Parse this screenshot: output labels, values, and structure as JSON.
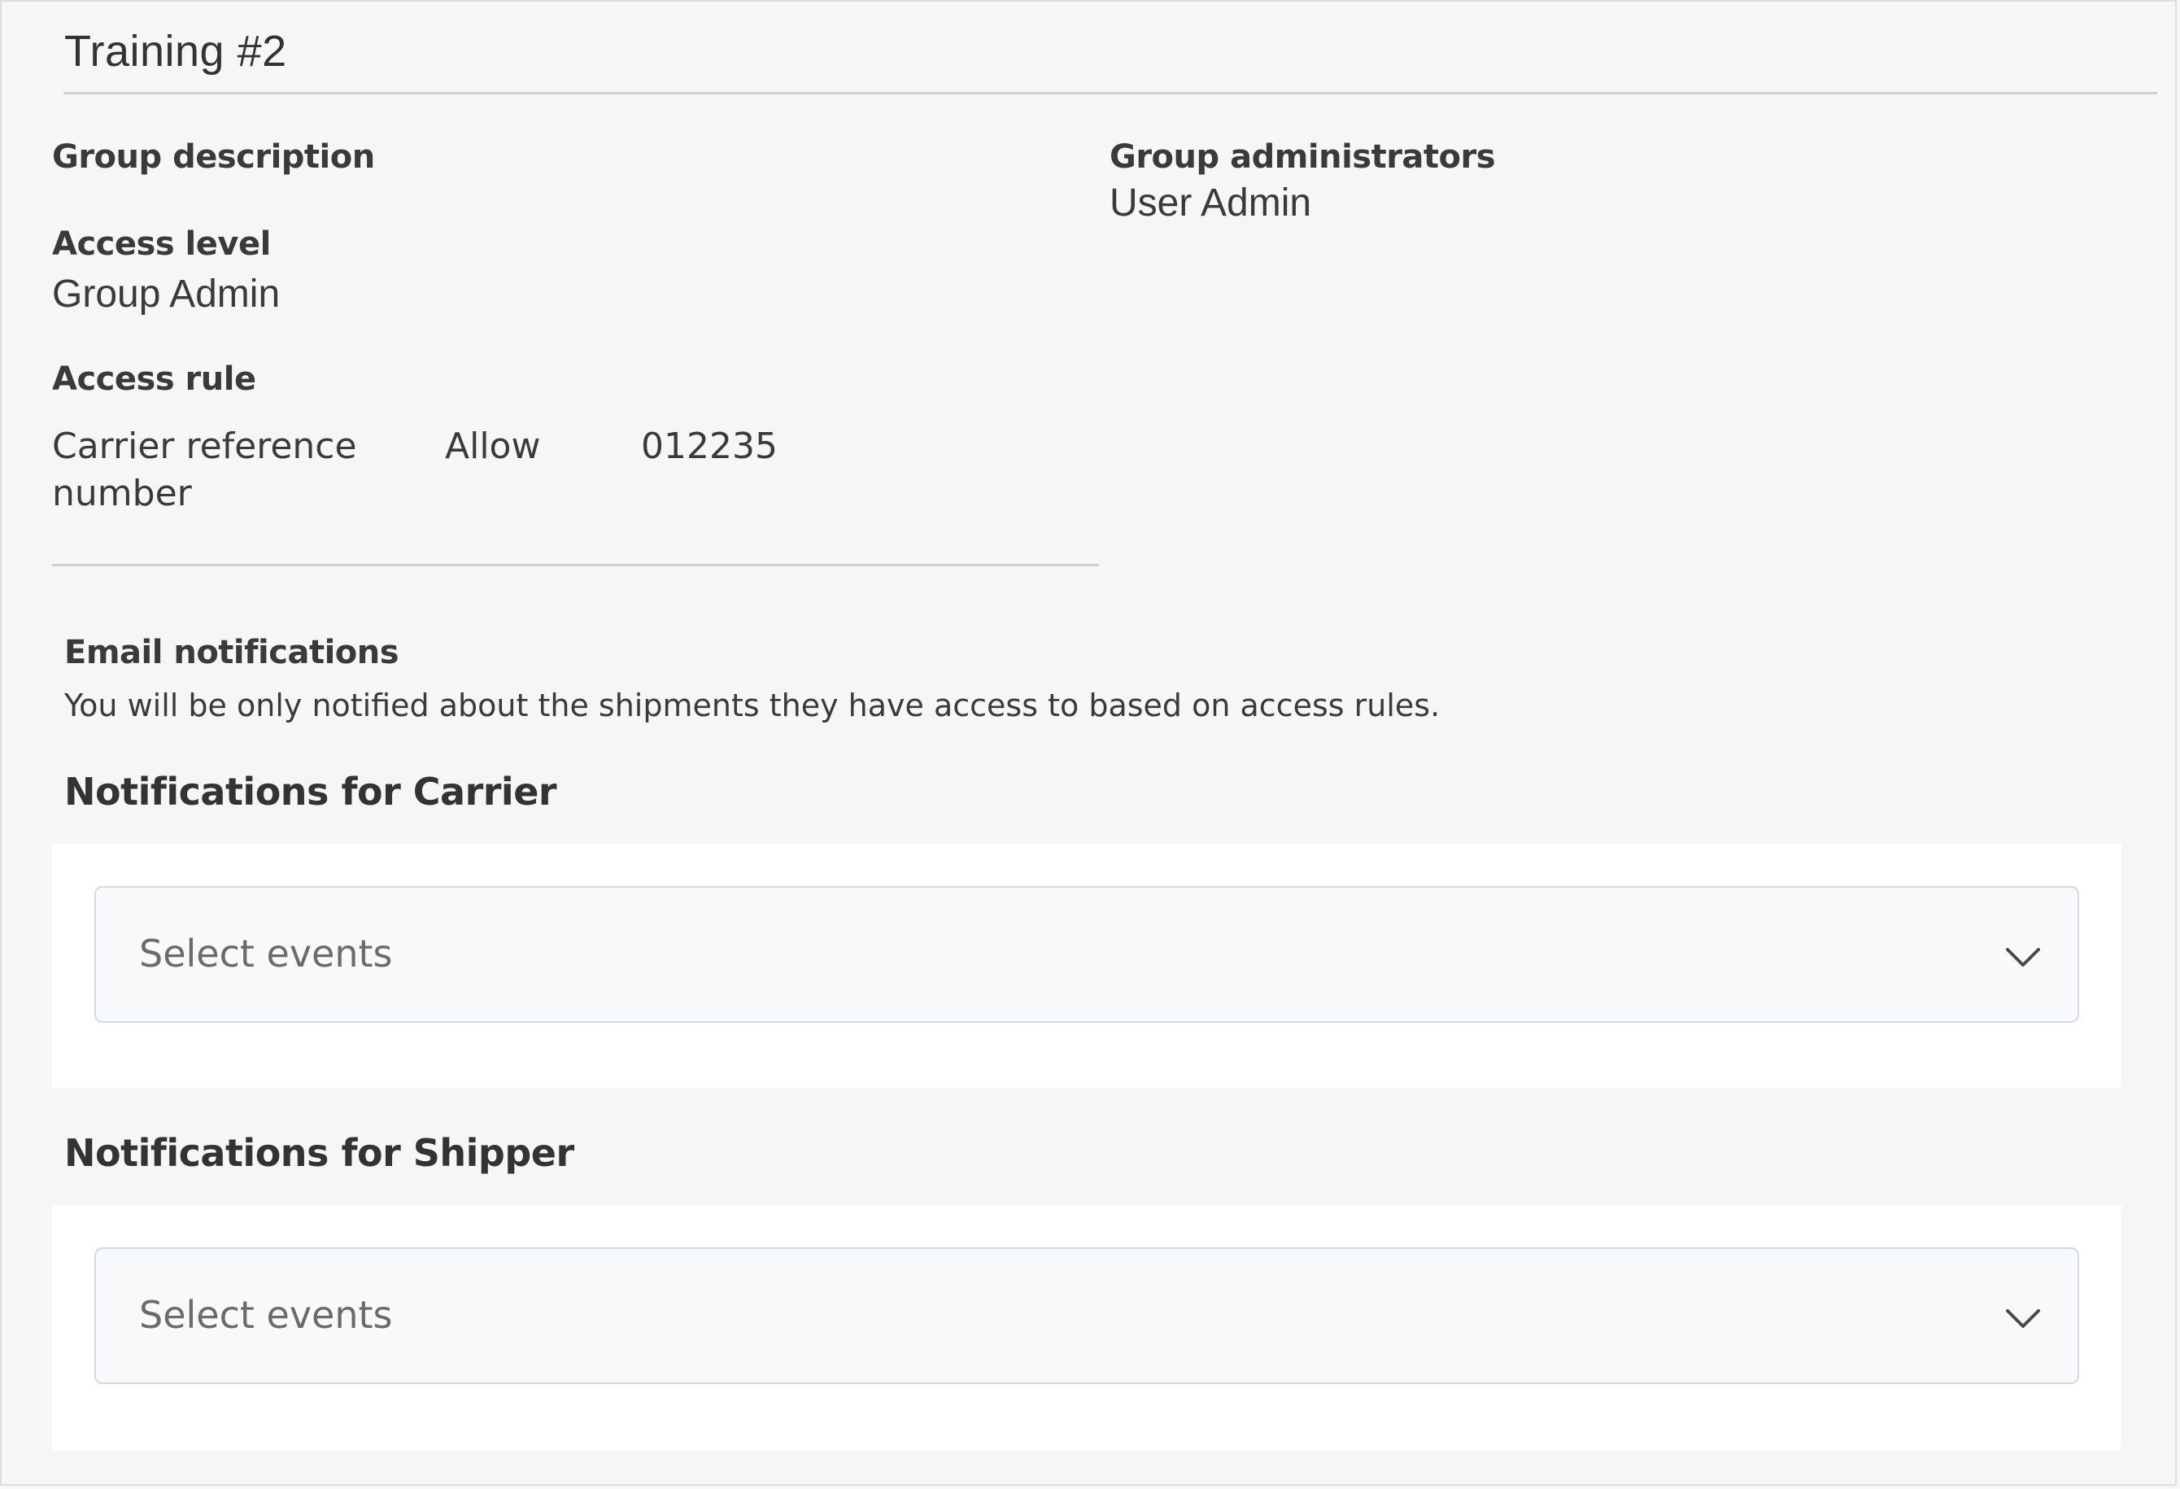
{
  "group": {
    "title": "Training #2"
  },
  "details": {
    "description_label": "Group description",
    "access_level_label": "Access level",
    "access_level_value": "Group Admin",
    "access_rule_label": "Access rule",
    "access_rule": {
      "field": "Carrier reference number",
      "field_line1": "Carrier reference",
      "field_line2": "number",
      "operator": "Allow",
      "value": "012235"
    },
    "administrators_label": "Group administrators",
    "administrators": [
      "User Admin"
    ]
  },
  "notifications": {
    "heading": "Email notifications",
    "hint": "You will be only notified about the shipments they have access to based on access rules.",
    "carrier": {
      "heading": "Notifications for Carrier",
      "placeholder": "Select events",
      "icon": "chevron-down-icon"
    },
    "shipper": {
      "heading": "Notifications for Shipper",
      "placeholder": "Select events",
      "icon": "chevron-down-icon"
    }
  }
}
